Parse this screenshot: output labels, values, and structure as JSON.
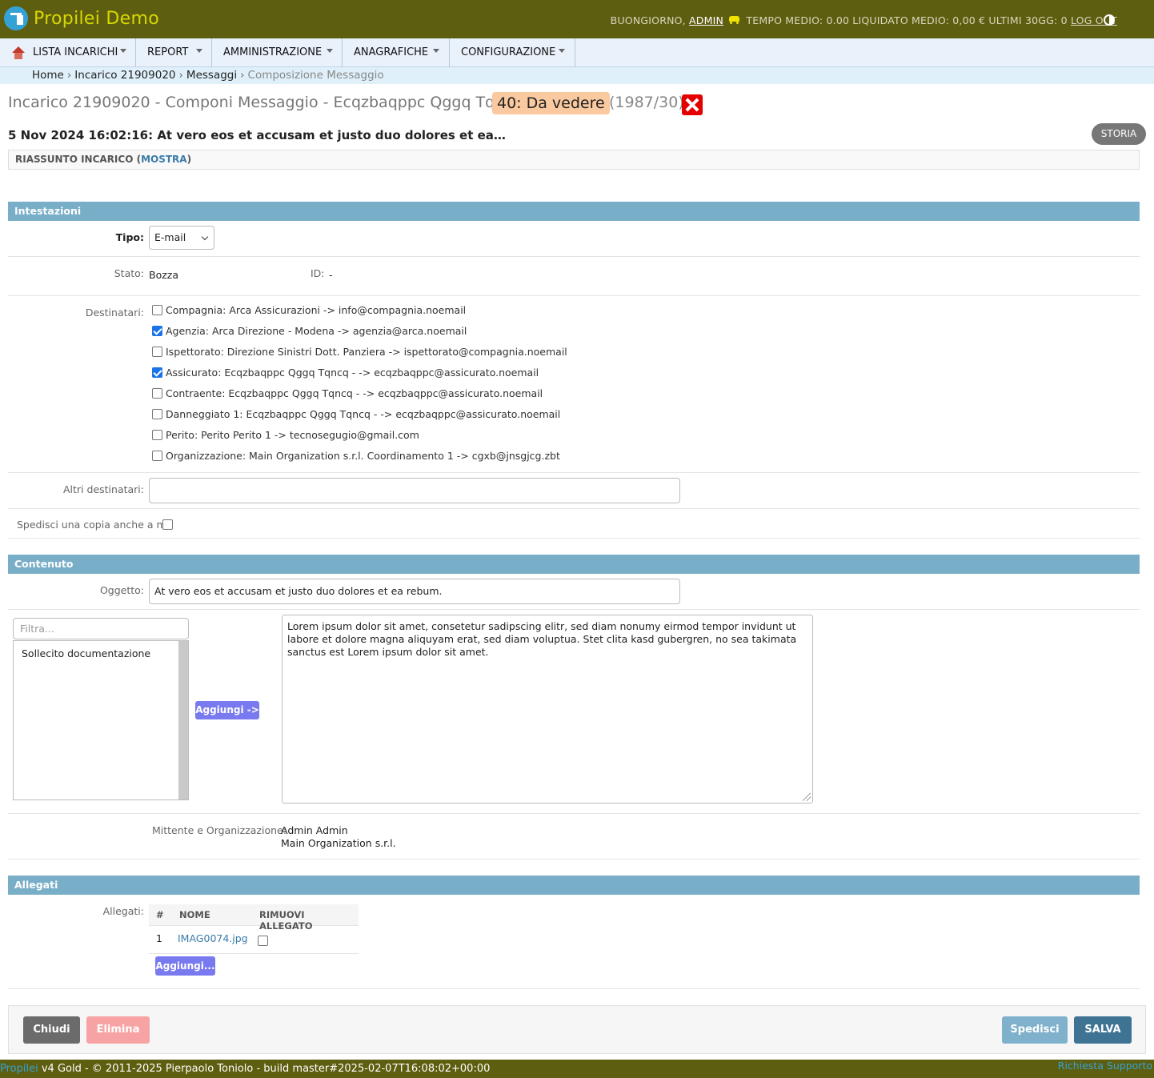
{
  "header": {
    "app_title": "Propilei Demo",
    "greeting": "BUONGIORNO,",
    "user": "ADMIN",
    "stats": "TEMPO MEDIO: 0.00 LIQUIDATO MEDIO: 0,00 € ULTIMI 30GG: 0",
    "logout": "LOG OUT"
  },
  "menu": [
    {
      "label": "LISTA INCARICHI"
    },
    {
      "label": "REPORT"
    },
    {
      "label": "AMMINISTRAZIONE"
    },
    {
      "label": "ANAGRAFICHE"
    },
    {
      "label": "CONFIGURAZIONE"
    }
  ],
  "breadcrumb": [
    "Home",
    "Incarico 21909020",
    "Messaggi",
    "Composizione Messaggio"
  ],
  "page": {
    "title": "Incarico 21909020 - Componi Messaggio - Ecqzbaqppc Qggq Tqncq",
    "status_badge": "40: Da vedere",
    "count": "(1987/30)",
    "subheading": "5 Nov 2024 16:02:16: At vero eos et accusam et justo duo dolores et ea…",
    "storia_button": "STORIA",
    "summary_label": "RIASSUNTO INCARICO (",
    "summary_link": "MOSTRA",
    "summary_close": ")"
  },
  "intestazioni": {
    "section_title": "Intestazioni",
    "tipo_label": "Tipo:",
    "tipo_value": "E-mail",
    "stato_label": "Stato:",
    "stato_value": "Bozza",
    "id_label": "ID:",
    "id_value": "-",
    "destinatari_label": "Destinatari:",
    "recipients": [
      {
        "text": "Compagnia: Arca Assicurazioni -> info@compagnia.noemail",
        "checked": false
      },
      {
        "text": "Agenzia: Arca Direzione - Modena -> agenzia@arca.noemail",
        "checked": true
      },
      {
        "text": "Ispettorato: Direzione Sinistri Dott. Panziera -> ispettorato@compagnia.noemail",
        "checked": false
      },
      {
        "text": "Assicurato: Ecqzbaqppc Qggq Tqncq - -> ecqzbaqppc@assicurato.noemail",
        "checked": true
      },
      {
        "text": "Contraente: Ecqzbaqppc Qggq Tqncq - -> ecqzbaqppc@assicurato.noemail",
        "checked": false
      },
      {
        "text": "Danneggiato 1: Ecqzbaqppc Qggq Tqncq - -> ecqzbaqppc@assicurato.noemail",
        "checked": false
      },
      {
        "text": "Perito: Perito Perito 1 -> tecnosegugio@gmail.com",
        "checked": false
      },
      {
        "text": "Organizzazione: Main Organization s.r.l. Coordinamento 1 -> cgxb@jnsgjcg.zbt",
        "checked": false
      }
    ],
    "altri_label": "Altri destinatari:",
    "altri_value": "",
    "copia_label": "Spedisci una copia anche a me"
  },
  "contenuto": {
    "section_title": "Contenuto",
    "oggetto_label": "Oggetto:",
    "oggetto_value": "At vero eos et accusam et justo duo dolores et ea rebum.",
    "filter_placeholder": "Filtra...",
    "templates": [
      "Sollecito documentazione"
    ],
    "add_button": "Aggiungi ->",
    "body": "Lorem ipsum dolor sit amet, consetetur sadipscing elitr, sed diam nonumy eirmod tempor invidunt ut labore et dolore magna aliquyam erat, sed diam voluptua. Stet clita kasd gubergren, no sea takimata sanctus est Lorem ipsum dolor sit amet.",
    "mittente_label": "Mittente e Organizzazione:",
    "mittente_name": "Admin Admin",
    "mittente_org": "Main Organization s.r.l."
  },
  "allegati": {
    "section_title": "Allegati",
    "label": "Allegati:",
    "columns": [
      "#",
      "NOME",
      "RIMUOVI ALLEGATO"
    ],
    "rows": [
      {
        "n": "1",
        "name": "IMAG0074.jpg"
      }
    ],
    "add_button": "Aggiungi..."
  },
  "actions": {
    "chiudi": "Chiudi",
    "elimina": "Elimina",
    "spedisci": "Spedisci",
    "salva": "SALVA"
  },
  "footer": {
    "brand": "Propilei",
    "text": " v4 Gold - © 2011-2025 Pierpaolo Toniolo - build master#2025-02-07T16:08:02+00:00",
    "support": "Richiesta Supporto"
  },
  "colors": {
    "header_bg": "#5e5e10",
    "section_bar": "#79aec8",
    "status_badge": "#fbc99f",
    "accent_button": "#7a7af0",
    "save_button": "#3f7394"
  }
}
